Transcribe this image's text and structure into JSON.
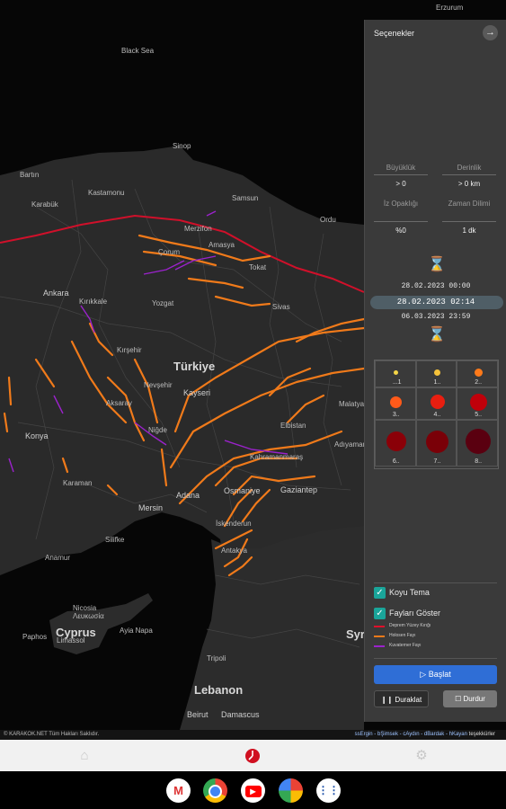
{
  "map": {
    "labels": [
      {
        "name": "Karadeniz",
        "text": "Black Sea"
      },
      {
        "name": "Sinop",
        "text": "Sinop"
      },
      {
        "name": "Bartin",
        "text": "Bartın"
      },
      {
        "name": "Karabuk",
        "text": "Karabük"
      },
      {
        "name": "Kastamonu",
        "text": "Kastamonu"
      },
      {
        "name": "Samsun",
        "text": "Samsun"
      },
      {
        "name": "Corum",
        "text": "Çorum"
      },
      {
        "name": "Merzifon",
        "text": "Merzifon"
      },
      {
        "name": "Amasya",
        "text": "Amasya"
      },
      {
        "name": "Tokat",
        "text": "Tokat"
      },
      {
        "name": "Ordu",
        "text": "Ordu"
      },
      {
        "name": "Ankara",
        "text": "Ankara"
      },
      {
        "name": "Kirikkale",
        "text": "Kırıkkale"
      },
      {
        "name": "Yozgat",
        "text": "Yozgat"
      },
      {
        "name": "Sivas",
        "text": "Sivas"
      },
      {
        "name": "Kirsehir",
        "text": "Kırşehir"
      },
      {
        "name": "Turkiye",
        "text": "Türkiye"
      },
      {
        "name": "Kayseri",
        "text": "Kayseri"
      },
      {
        "name": "Nevsehir",
        "text": "Nevşehir"
      },
      {
        "name": "Aksaray",
        "text": "Aksaray"
      },
      {
        "name": "Nigde",
        "text": "Niğde"
      },
      {
        "name": "Konya",
        "text": "Konya"
      },
      {
        "name": "Karaman",
        "text": "Karaman"
      },
      {
        "name": "Malatya",
        "text": "Malatya"
      },
      {
        "name": "Elbistan",
        "text": "Elbistan"
      },
      {
        "name": "Adiyaman",
        "text": "Adıyaman"
      },
      {
        "name": "Kahramanmaras",
        "text": "Kahramanmaraş"
      },
      {
        "name": "Osmaniye",
        "text": "Osmaniye"
      },
      {
        "name": "Gaziantep",
        "text": "Gaziantep"
      },
      {
        "name": "Adana",
        "text": "Adana"
      },
      {
        "name": "Mersin",
        "text": "Mersin"
      },
      {
        "name": "Iskenderun",
        "text": "İskenderun"
      },
      {
        "name": "Silifke",
        "text": "Silifke"
      },
      {
        "name": "Anamur",
        "text": "Anamur"
      },
      {
        "name": "Antakya",
        "text": "Antakya"
      },
      {
        "name": "Nicosia",
        "text": "Nicosia"
      },
      {
        "name": "Lefkosa",
        "text": "Λευκωσία"
      },
      {
        "name": "Cyprus",
        "text": "Cyprus"
      },
      {
        "name": "Paphos",
        "text": "Paphos"
      },
      {
        "name": "Limassol",
        "text": "Limassol"
      },
      {
        "name": "AyiaNapa",
        "text": "Ayia Napa"
      },
      {
        "name": "Lebanon",
        "text": "Lebanon"
      },
      {
        "name": "Tripoli",
        "text": "Tripoli"
      },
      {
        "name": "Beirut",
        "text": "Beirut"
      },
      {
        "name": "Damascus",
        "text": "Damascus"
      },
      {
        "name": "Syria",
        "text": "Syr"
      },
      {
        "name": "Erzurum",
        "text": "Erzurum"
      }
    ]
  },
  "panel": {
    "title": "Seçenekler",
    "close_icon": "arrow-right-circle-icon",
    "magnitude_label": "Büyüklük",
    "magnitude_value": "> 0",
    "depth_label": "Derinlik",
    "depth_value": "> 0 km",
    "trace_label": "İz Opaklığı",
    "trace_value": "%0",
    "time_step_label": "Zaman Dilimi",
    "time_step_value": "1 dk",
    "start_time": "28.02.2023 00:00",
    "current_time": "28.02.2023 02:14",
    "end_time": "06.03.2023 23:59",
    "magnitude_cells": [
      {
        "label": "...1",
        "color": "#f5d547",
        "size": 5
      },
      {
        "label": "1..",
        "color": "#f5c23a",
        "size": 7
      },
      {
        "label": "2..",
        "color": "#ff7a1a",
        "size": 9
      },
      {
        "label": "3..",
        "color": "#ff5a1a",
        "size": 13
      },
      {
        "label": "4..",
        "color": "#e81e10",
        "size": 16
      },
      {
        "label": "5..",
        "color": "#c0000a",
        "size": 19
      },
      {
        "label": "6..",
        "color": "#8a0008",
        "size": 22
      },
      {
        "label": "7..",
        "color": "#7a0008",
        "size": 25
      },
      {
        "label": "8..",
        "color": "#5a0010",
        "size": 28
      }
    ],
    "dark_theme_label": "Koyu Tema",
    "show_faults_label": "Fayları Göster",
    "legend": [
      {
        "label": "Deprem Yüzey Kırığı",
        "color": "#e0102a"
      },
      {
        "label": "Holosen Fayı",
        "color": "#f07a1a"
      },
      {
        "label": "Kuvaterner Fayı",
        "color": "#9b22cc"
      }
    ],
    "start_button": "▷ Başlat",
    "pause_button": "❙❙ Duraklat",
    "stop_button": "☐ Durdur"
  },
  "footer": {
    "copyright": "© KARAKOK.NET Tüm Hakları Saklıdır.",
    "credits": [
      "ssErgin",
      "bŞimsek",
      "cAydın",
      "dBardak",
      "hKayan"
    ],
    "credits_suffix": "teşekkürler"
  },
  "taskbar": {
    "apps": [
      "gmail-icon",
      "chrome-icon",
      "youtube-icon",
      "photos-icon",
      "app-drawer-icon"
    ]
  }
}
